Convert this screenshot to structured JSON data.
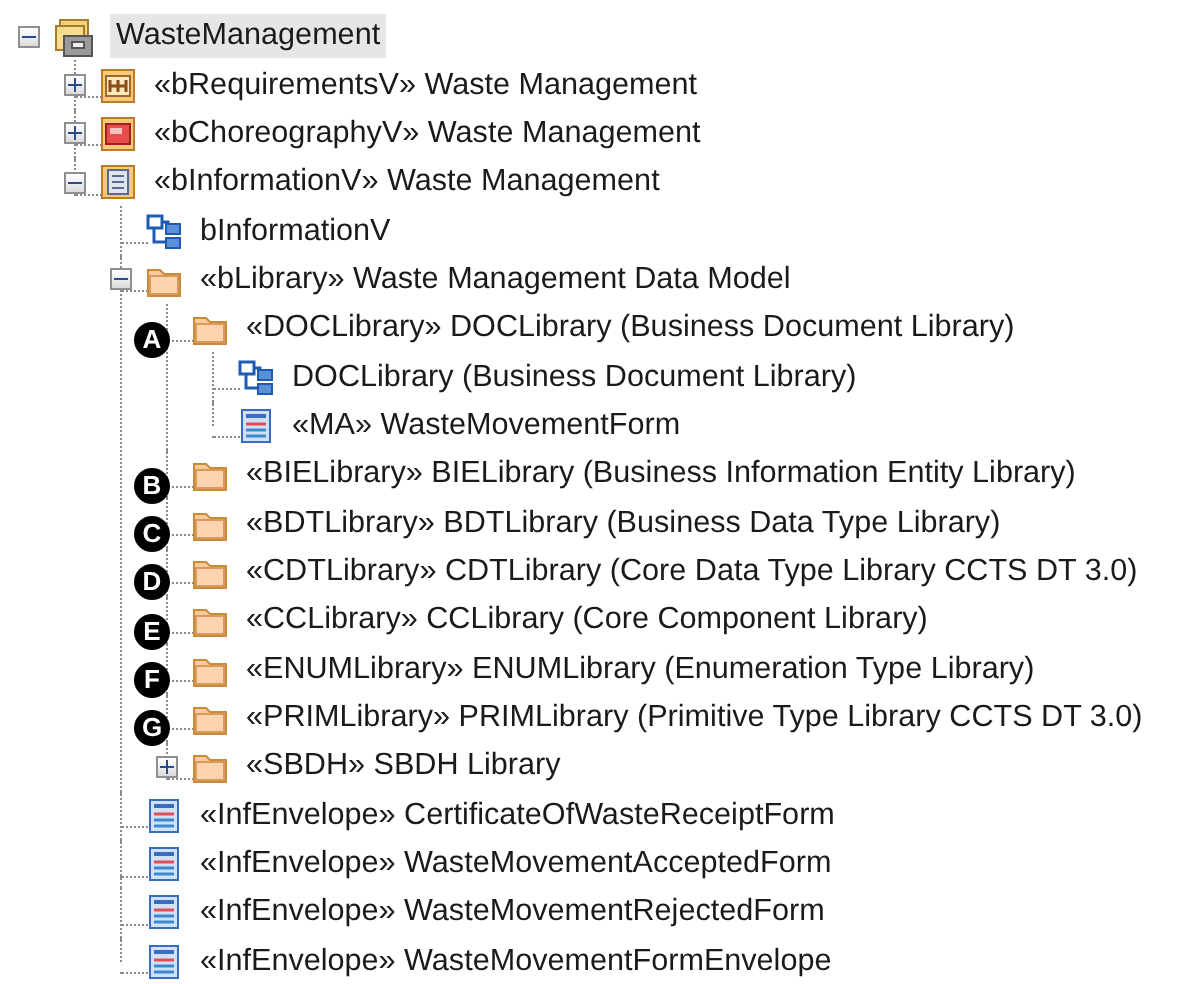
{
  "tree": [
    {
      "label": "WasteManagement",
      "kind": "model",
      "expanded": true,
      "selected": true,
      "children": [
        {
          "label": "«bRequirementsV» Waste Management",
          "kind": "requirements",
          "expanded": false,
          "selected": false
        },
        {
          "label": "«bChoreographyV» Waste Management",
          "kind": "choreography",
          "expanded": false,
          "selected": false
        },
        {
          "label": "«bInformationV» Waste Management",
          "kind": "information",
          "expanded": true,
          "selected": false,
          "children": [
            {
              "label": "bInformationV",
              "kind": "diagram",
              "selected": false
            },
            {
              "label": "«bLibrary» Waste Management Data Model",
              "kind": "folder",
              "expanded": true,
              "selected": false,
              "children": [
                {
                  "label": "«DOCLibrary» DOCLibrary (Business Document Library)",
                  "kind": "folder",
                  "callout": "A",
                  "selected": false,
                  "children": [
                    {
                      "label": "DOCLibrary (Business Document Library)",
                      "kind": "diagram",
                      "selected": false
                    },
                    {
                      "label": "«MA» WasteMovementForm",
                      "kind": "form",
                      "selected": false
                    }
                  ]
                },
                {
                  "label": "«BIELibrary» BIELibrary (Business Information Entity Library)",
                  "kind": "folder",
                  "callout": "B",
                  "selected": false
                },
                {
                  "label": "«BDTLibrary» BDTLibrary (Business Data Type Library)",
                  "kind": "folder",
                  "callout": "C",
                  "selected": false
                },
                {
                  "label": "«CDTLibrary» CDTLibrary (Core Data Type Library CCTS DT 3.0)",
                  "kind": "folder",
                  "callout": "D",
                  "selected": false
                },
                {
                  "label": "«CCLibrary» CCLibrary (Core Component Library)",
                  "kind": "folder",
                  "callout": "E",
                  "selected": false
                },
                {
                  "label": "«ENUMLibrary» ENUMLibrary (Enumeration Type Library)",
                  "kind": "folder",
                  "callout": "F",
                  "selected": false
                },
                {
                  "label": "«PRIMLibrary» PRIMLibrary (Primitive Type Library CCTS DT 3.0)",
                  "kind": "folder",
                  "callout": "G",
                  "selected": false
                },
                {
                  "label": "«SBDH» SBDH Library",
                  "kind": "folder",
                  "expanded": false,
                  "selected": false
                }
              ]
            },
            {
              "label": "«InfEnvelope» CertificateOfWasteReceiptForm",
              "kind": "form",
              "selected": false
            },
            {
              "label": "«InfEnvelope» WasteMovementAcceptedForm",
              "kind": "form",
              "selected": false
            },
            {
              "label": "«InfEnvelope» WasteMovementRejectedForm",
              "kind": "form",
              "selected": false
            },
            {
              "label": "«InfEnvelope» WasteMovementFormEnvelope",
              "kind": "form",
              "selected": false
            }
          ]
        }
      ]
    }
  ]
}
